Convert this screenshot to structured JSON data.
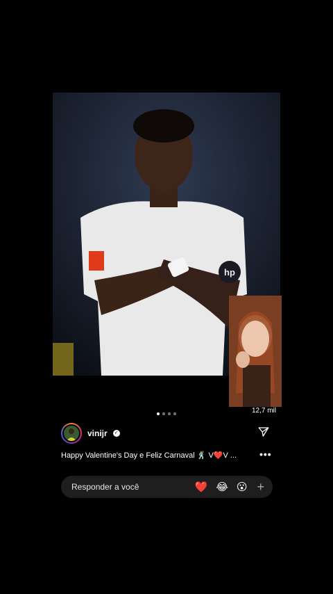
{
  "post": {
    "image_description_icon": "player-photo",
    "carousel": {
      "total": 4,
      "active": 0
    },
    "views": "12,7 mil"
  },
  "author": {
    "username": "vinijr",
    "verified_glyph": "✓"
  },
  "caption": {
    "text": "Happy Valentine's Day e Feliz Carnaval 🕺 V❤️V ..."
  },
  "more_glyph": "•••",
  "reply": {
    "placeholder": "Responder a você",
    "emojis": [
      "❤️",
      "😂",
      "😮"
    ],
    "add_glyph": "+"
  },
  "colors": {
    "background": "#000000",
    "reply_bar": "#1e1e1e",
    "heart": "#e0102a"
  }
}
